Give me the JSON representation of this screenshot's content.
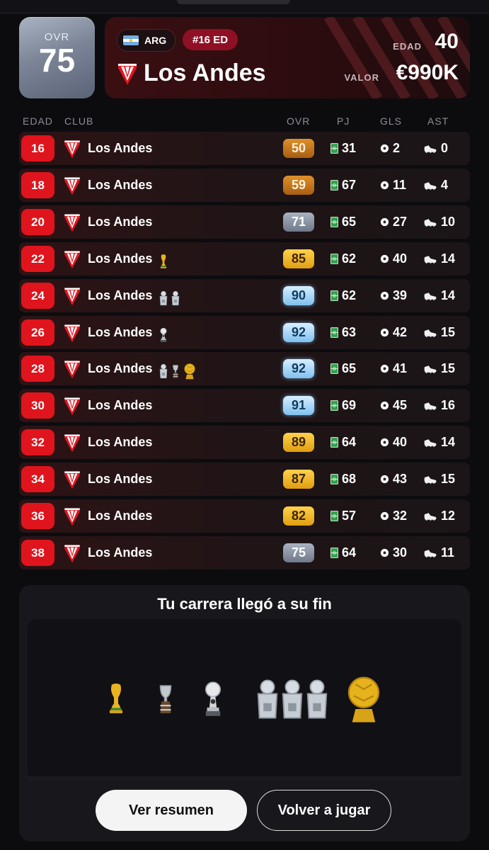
{
  "header": {
    "ovr_label": "OVR",
    "ovr_value": "75",
    "nationality_code": "ARG",
    "edition_badge": "#16 ED",
    "club_name": "Los Andes",
    "age_label": "EDAD",
    "age_value": "40",
    "value_label": "VALOR",
    "value_amount": "€990K"
  },
  "table": {
    "headers": {
      "age": "EDAD",
      "club": "CLUB",
      "ovr": "OVR",
      "pj": "PJ",
      "gls": "GLS",
      "ast": "AST"
    },
    "rows": [
      {
        "age": "16",
        "club": "Los Andes",
        "trophies": [],
        "ovr": "50",
        "ovr_tier": "bronze",
        "pj": "31",
        "gls": "2",
        "ast": "0"
      },
      {
        "age": "18",
        "club": "Los Andes",
        "trophies": [],
        "ovr": "59",
        "ovr_tier": "bronze",
        "pj": "67",
        "gls": "11",
        "ast": "4"
      },
      {
        "age": "20",
        "club": "Los Andes",
        "trophies": [],
        "ovr": "71",
        "ovr_tier": "silver",
        "pj": "65",
        "gls": "27",
        "ast": "10"
      },
      {
        "age": "22",
        "club": "Los Andes",
        "trophies": [
          "world-cup"
        ],
        "ovr": "85",
        "ovr_tier": "gold",
        "pj": "62",
        "gls": "40",
        "ast": "14"
      },
      {
        "age": "24",
        "club": "Los Andes",
        "trophies": [
          "league",
          "league"
        ],
        "ovr": "90",
        "ovr_tier": "blue",
        "pj": "62",
        "gls": "39",
        "ast": "14"
      },
      {
        "age": "26",
        "club": "Los Andes",
        "trophies": [
          "sudamericana"
        ],
        "ovr": "92",
        "ovr_tier": "blue",
        "pj": "63",
        "gls": "42",
        "ast": "15"
      },
      {
        "age": "28",
        "club": "Los Andes",
        "trophies": [
          "league",
          "copa-america",
          "ballon-dor"
        ],
        "ovr": "92",
        "ovr_tier": "blue",
        "pj": "65",
        "gls": "41",
        "ast": "15"
      },
      {
        "age": "30",
        "club": "Los Andes",
        "trophies": [],
        "ovr": "91",
        "ovr_tier": "blue",
        "pj": "69",
        "gls": "45",
        "ast": "16"
      },
      {
        "age": "32",
        "club": "Los Andes",
        "trophies": [],
        "ovr": "89",
        "ovr_tier": "gold",
        "pj": "64",
        "gls": "40",
        "ast": "14"
      },
      {
        "age": "34",
        "club": "Los Andes",
        "trophies": [],
        "ovr": "87",
        "ovr_tier": "gold",
        "pj": "68",
        "gls": "43",
        "ast": "15"
      },
      {
        "age": "36",
        "club": "Los Andes",
        "trophies": [],
        "ovr": "82",
        "ovr_tier": "gold",
        "pj": "57",
        "gls": "32",
        "ast": "12"
      },
      {
        "age": "38",
        "club": "Los Andes",
        "trophies": [],
        "ovr": "75",
        "ovr_tier": "silver",
        "pj": "64",
        "gls": "30",
        "ast": "11"
      }
    ]
  },
  "summary": {
    "title": "Tu carrera llegó a su fin",
    "trophies": [
      "world-cup",
      "copa-america",
      "sudamericana",
      "league",
      "league",
      "league",
      "ballon-dor"
    ],
    "primary_button": "Ver resumen",
    "secondary_button": "Volver a jugar"
  },
  "colors": {
    "age_badge": "#e0141c",
    "edition_badge": "#8f1024",
    "tier_bronze": "#c97a1e",
    "tier_silver": "#8b95a6",
    "tier_gold": "#f0b21a",
    "tier_blue": "#9ed0f5"
  }
}
